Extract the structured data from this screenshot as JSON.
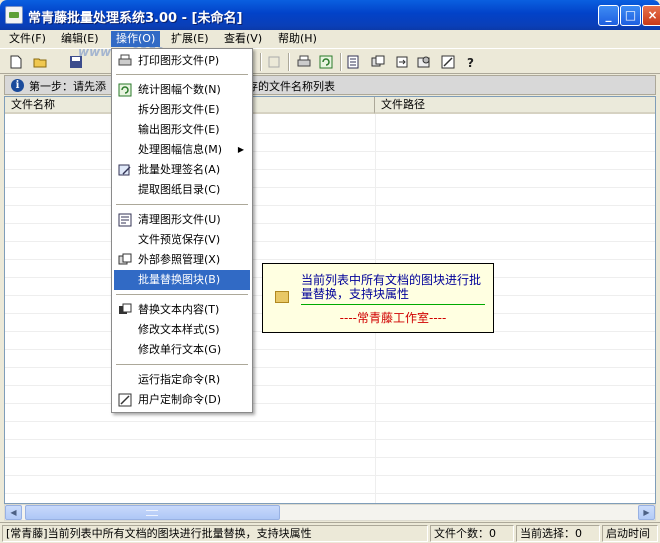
{
  "window": {
    "title": "常青藤批量处理系统3.00 - [未命名]",
    "minimize_label": "_",
    "maximize_label": "□",
    "close_label": "×"
  },
  "menubar": {
    "items": [
      {
        "label": "文件(F)"
      },
      {
        "label": "编辑(E)"
      },
      {
        "label": "操作(O)"
      },
      {
        "label": "扩展(E)"
      },
      {
        "label": "查看(V)"
      },
      {
        "label": "帮助(H)"
      }
    ]
  },
  "watermark": "www.pc0359.cn",
  "infobar": {
    "icon": "info-icon",
    "text": "第一步：请先添",
    "text_suffix": "保存的文件名称列表"
  },
  "listview": {
    "columns": [
      {
        "label": "文件名称"
      },
      {
        "label": "文件路径"
      }
    ],
    "rows": []
  },
  "dropdown": {
    "menu": "操作(O)",
    "items": [
      {
        "label": "打印图形文件(P)",
        "icon": "printer-icon"
      },
      {
        "label": "统计图幅个数(N)",
        "icon": "refresh-icon"
      },
      {
        "label": "拆分图形文件(E)"
      },
      {
        "label": "输出图形文件(E)"
      },
      {
        "label": "处理图幅信息(M)",
        "submenu": true
      },
      {
        "label": "批量处理签名(A)",
        "icon": "sign-icon"
      },
      {
        "label": "提取图纸目录(C)"
      },
      {
        "label": "清理图形文件(U)",
        "icon": "clean-icon"
      },
      {
        "label": "文件预览保存(V)"
      },
      {
        "label": "外部参照管理(X)",
        "icon": "xref-icon"
      },
      {
        "label": "批量替换图块(B)",
        "highlighted": true
      },
      {
        "label": "替换文本内容(T)",
        "icon": "replace-text-icon"
      },
      {
        "label": "修改文本样式(S)"
      },
      {
        "label": "修改单行文本(G)"
      },
      {
        "label": "运行指定命令(R)"
      },
      {
        "label": "用户定制命令(D)",
        "icon": "custom-command-icon"
      }
    ]
  },
  "tooltip": {
    "text": "当前列表中所有文档的图块进行批量替换，支持块属性",
    "signature": "----常青藤工作室----"
  },
  "statusbar": {
    "message": "[常青藤]当前列表中所有文档的图块进行批量替换，支持块属性",
    "file_count": "文件个数：0",
    "selected_count": "当前选择：0",
    "start_time": "启动时间"
  }
}
